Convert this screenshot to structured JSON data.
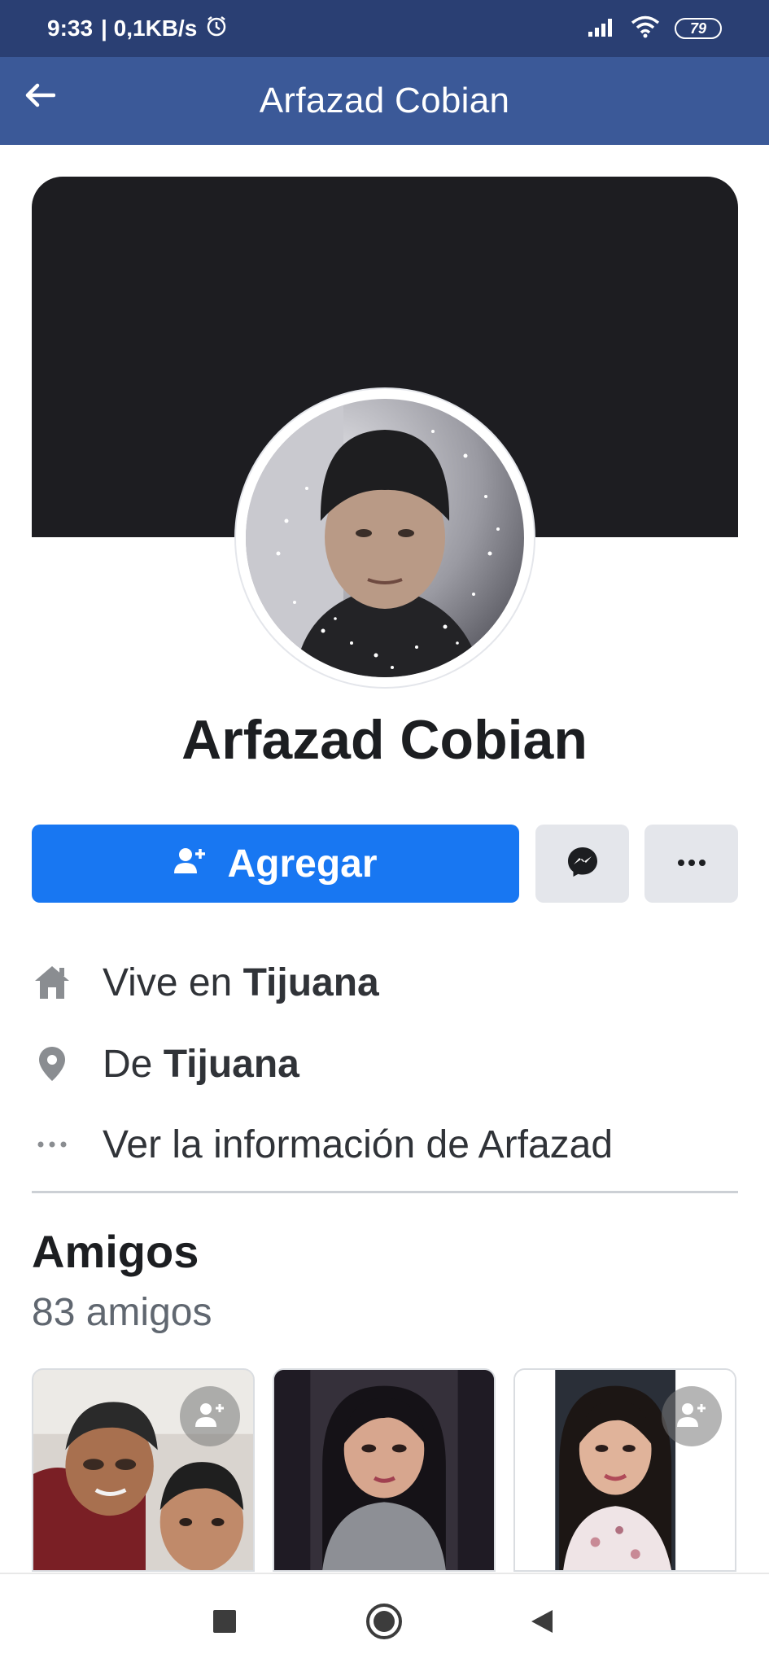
{
  "status_bar": {
    "time": "9:33",
    "speed": "| 0,1KB/s",
    "battery": "79",
    "icons": [
      "alarm-icon",
      "signal-icon",
      "wifi-icon",
      "battery-icon"
    ]
  },
  "header": {
    "title": "Arfazad Cobian",
    "back_icon": "back-arrow-icon"
  },
  "profile": {
    "name": "Arfazad Cobian"
  },
  "actions": {
    "add_label": "Agregar",
    "add_icon": "add-friend-icon",
    "message_icon": "messenger-icon",
    "more_icon": "more-icon"
  },
  "info": {
    "lives_prefix": "Vive en",
    "lives_city": "Tijuana",
    "from_prefix": "De",
    "from_city": "Tijuana",
    "see_info": "Ver la información de Arfazad"
  },
  "friends": {
    "title": "Amigos",
    "count": "83 amigos"
  },
  "colors": {
    "status_bar": "#2a3f73",
    "header": "#3b5998",
    "primary_button": "#1877f2",
    "secondary_button": "#e4e6eb",
    "cover": "#1d1d21"
  }
}
